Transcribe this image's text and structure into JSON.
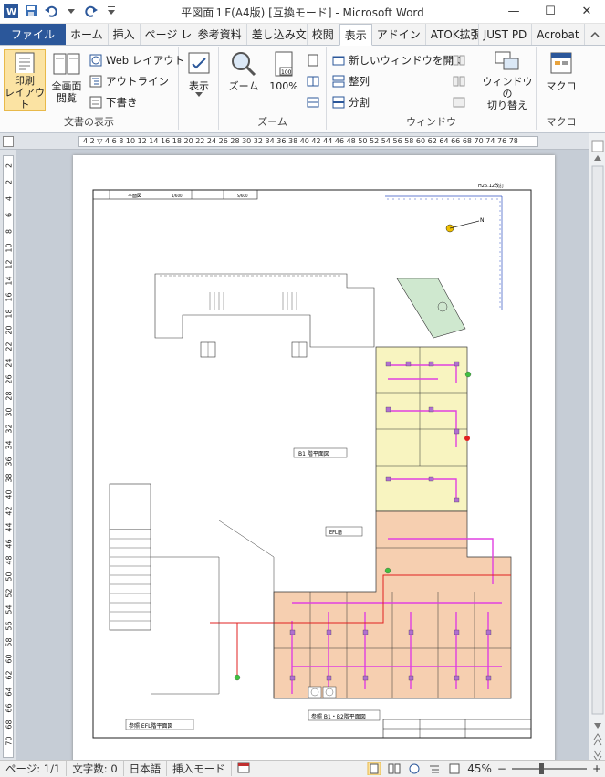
{
  "title_bar": {
    "title": "平図面１F(A4版) [互換モード] - Microsoft Word",
    "minimize": "—",
    "maximize": "☐",
    "close": "✕"
  },
  "tabs": [
    "ファイル",
    "ホーム",
    "挿入",
    "ページ レイ",
    "参考資料",
    "差し込み文",
    "校閲",
    "表示",
    "アドイン",
    "ATOK拡張",
    "JUST PD",
    "Acrobat"
  ],
  "ribbon": {
    "doc_view": {
      "print_layout": "印刷\nレイアウト",
      "full_screen": "全画面\n閲覧",
      "web_layout": "Web レイアウト",
      "outline": "アウトライン",
      "draft": "下書き",
      "label": "文書の表示"
    },
    "show": {
      "label": "表示"
    },
    "zoom": {
      "zoom": "ズーム",
      "hundred": "100%",
      "label": "ズーム"
    },
    "window": {
      "new_window": "新しいウィンドウを開く",
      "arrange": "整列",
      "split": "分割",
      "switch": "ウィンドウの\n切り替え",
      "label": "ウィンドウ"
    },
    "macro": {
      "macro": "マクロ",
      "label": "マクロ"
    }
  },
  "ruler": {
    "h_labels": "4  2  ▽  4  6  8  10  12  14  16  18  20  22  24  26  28  30  32  34  36  38  40  42  44  46  48  50  52  54  56  58  60  62  64  66  68  70    74 76 78",
    "v_labels": [
      "2",
      "2",
      "4",
      "6",
      "8",
      "10",
      "12",
      "14",
      "16",
      "18",
      "20",
      "22",
      "24",
      "26",
      "28",
      "30",
      "32",
      "34",
      "36",
      "38",
      "40",
      "42",
      "44",
      "46",
      "48",
      "50",
      "52",
      "54",
      "56",
      "58",
      "60",
      "62",
      "64",
      "66",
      "68",
      "70"
    ]
  },
  "drawing": {
    "label_b1": "B1 階平面図",
    "label_bottom_left": "参照 EFL階平面図",
    "label_bottom_mid": "参照 B1・B2階平面図",
    "label_small": "EFL階",
    "corner_note": "H26.12改訂",
    "north": "N",
    "header_cells": [
      "平面図",
      "1/600",
      "",
      "S/600"
    ]
  },
  "status": {
    "page": "ページ: 1/1",
    "words": "文字数: 0",
    "lang": "日本語",
    "mode": "挿入モード",
    "zoom_pct": "45%",
    "minus": "−",
    "plus": "+"
  }
}
